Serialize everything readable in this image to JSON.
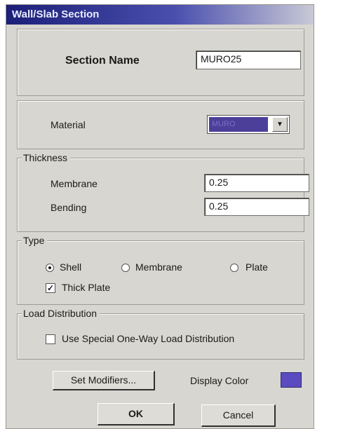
{
  "window": {
    "title": "Wall/Slab Section"
  },
  "section_name": {
    "label": "Section Name",
    "value": "MURO25"
  },
  "material": {
    "label": "Material",
    "selected": "MURO"
  },
  "thickness": {
    "group_label": "Thickness",
    "membrane_label": "Membrane",
    "membrane_value": "0.25",
    "bending_label": "Bending",
    "bending_value": "0.25"
  },
  "type": {
    "group_label": "Type",
    "options": [
      "Shell",
      "Membrane",
      "Plate"
    ],
    "selected": "Shell",
    "thick_plate_label": "Thick Plate",
    "thick_plate_checked": true
  },
  "load_distribution": {
    "group_label": "Load Distribution",
    "special_label": "Use Special One-Way Load Distribution",
    "special_checked": false
  },
  "buttons": {
    "set_modifiers": "Set Modifiers...",
    "display_color_label": "Display Color",
    "ok": "OK",
    "cancel": "Cancel"
  },
  "colors": {
    "display_color": "#5a4cc0",
    "titlebar": "#1c1f78"
  },
  "icons": {
    "combo_arrow": "chevron-down-icon",
    "thick_plate_check": "checkmark-icon"
  }
}
